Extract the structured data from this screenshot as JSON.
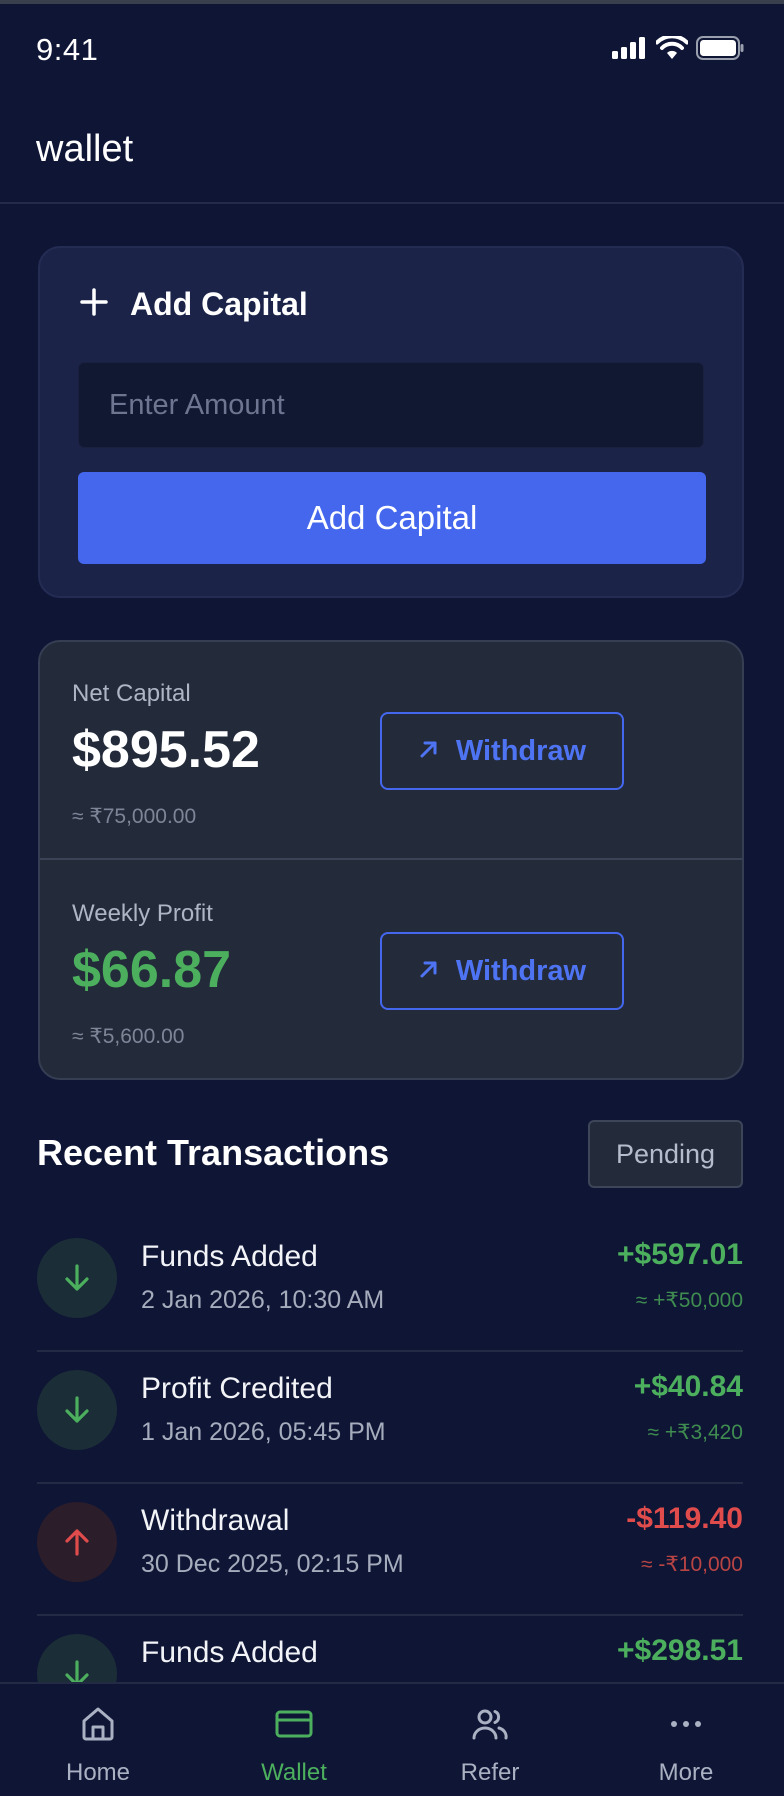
{
  "status_bar": {
    "time": "9:41"
  },
  "header": {
    "title": "wallet"
  },
  "add_capital": {
    "title": "Add Capital",
    "input_placeholder": "Enter Amount",
    "input_value": "",
    "button_label": "Add Capital"
  },
  "balances": {
    "net_capital": {
      "label": "Net Capital",
      "value": "$895.52",
      "approx": "≈ ₹75,000.00",
      "button_label": "Withdraw"
    },
    "weekly_profit": {
      "label": "Weekly Profit",
      "value": "$66.87",
      "approx": "≈ ₹5,600.00",
      "button_label": "Withdraw"
    }
  },
  "transactions": {
    "title": "Recent Transactions",
    "pending_label": "Pending",
    "items": [
      {
        "title": "Funds Added",
        "date": "2 Jan 2026, 10:30 AM",
        "amount": "+$597.01",
        "approx": "≈ +₹50,000",
        "direction": "in"
      },
      {
        "title": "Profit Credited",
        "date": "1 Jan 2026, 05:45 PM",
        "amount": "+$40.84",
        "approx": "≈ +₹3,420",
        "direction": "in"
      },
      {
        "title": "Withdrawal",
        "date": "30 Dec 2025, 02:15 PM",
        "amount": "-$119.40",
        "approx": "≈ -₹10,000",
        "direction": "out"
      },
      {
        "title": "Funds Added",
        "date": "",
        "amount": "+$298.51",
        "approx": "",
        "direction": "in"
      }
    ]
  },
  "bottom_nav": {
    "items": [
      {
        "label": "Home",
        "icon": "home-icon"
      },
      {
        "label": "Wallet",
        "icon": "wallet-icon",
        "active": true
      },
      {
        "label": "Refer",
        "icon": "users-icon"
      },
      {
        "label": "More",
        "icon": "more-icon"
      }
    ]
  },
  "colors": {
    "background": "#0f1535",
    "card": "#1b2349",
    "balance_card": "#232b3b",
    "accent": "#4467ee",
    "positive": "#4caf5e",
    "negative": "#e04c4c"
  }
}
